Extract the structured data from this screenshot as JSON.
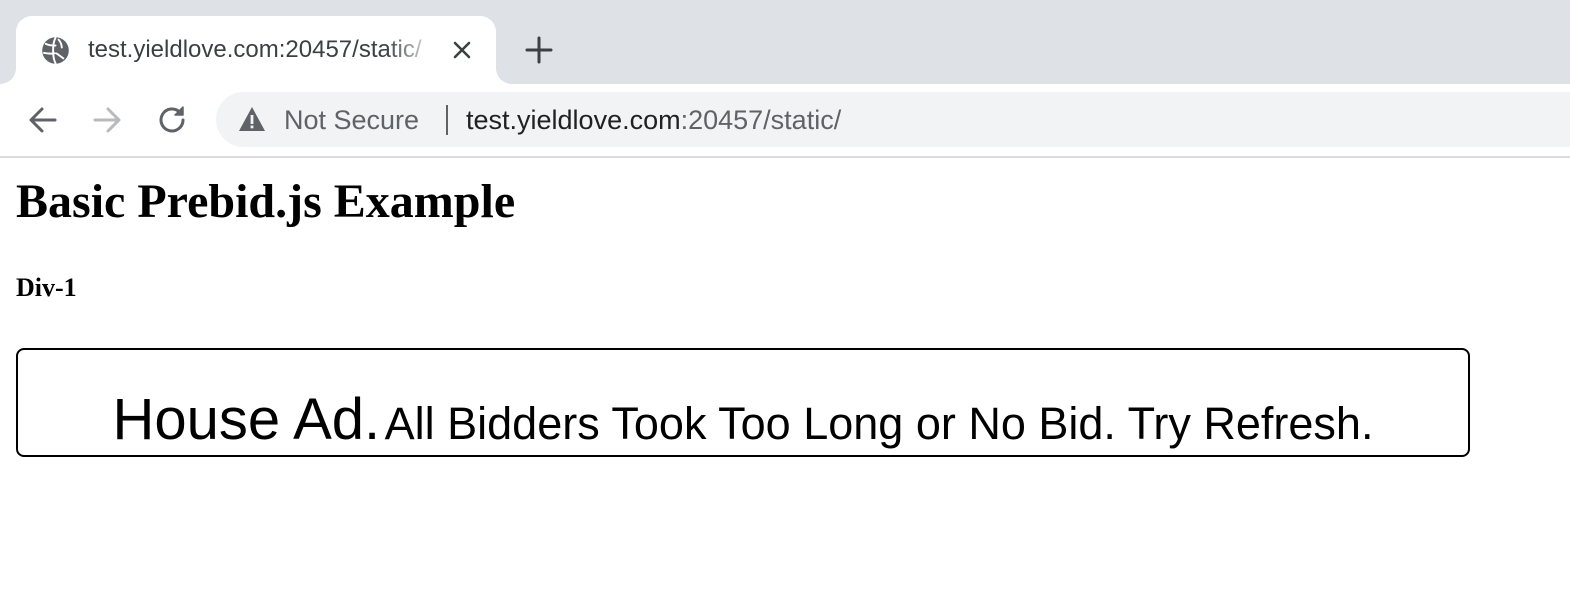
{
  "browser": {
    "tab": {
      "title": "test.yieldlove.com:20457/static/",
      "favicon_icon": "globe-icon",
      "close_icon": "close-icon"
    },
    "new_tab_icon": "plus-icon",
    "toolbar": {
      "back_icon": "arrow-left-icon",
      "forward_icon": "arrow-right-icon",
      "reload_icon": "reload-icon",
      "security_icon": "warning-triangle-icon",
      "security_label": "Not Secure",
      "url_host": "test.yieldlove.com",
      "url_rest": ":20457/static/"
    }
  },
  "page": {
    "title": "Basic Prebid.js Example",
    "div_label": "Div-1",
    "ad": {
      "headline": "House Ad.",
      "message": "All Bidders Took Too Long or No Bid. Try Refresh."
    }
  },
  "colors": {
    "tab_strip": "#dee1e6",
    "omnibox": "#f1f3f4",
    "icon_gray": "#5f6368",
    "forward_disabled": "#b8babc"
  }
}
